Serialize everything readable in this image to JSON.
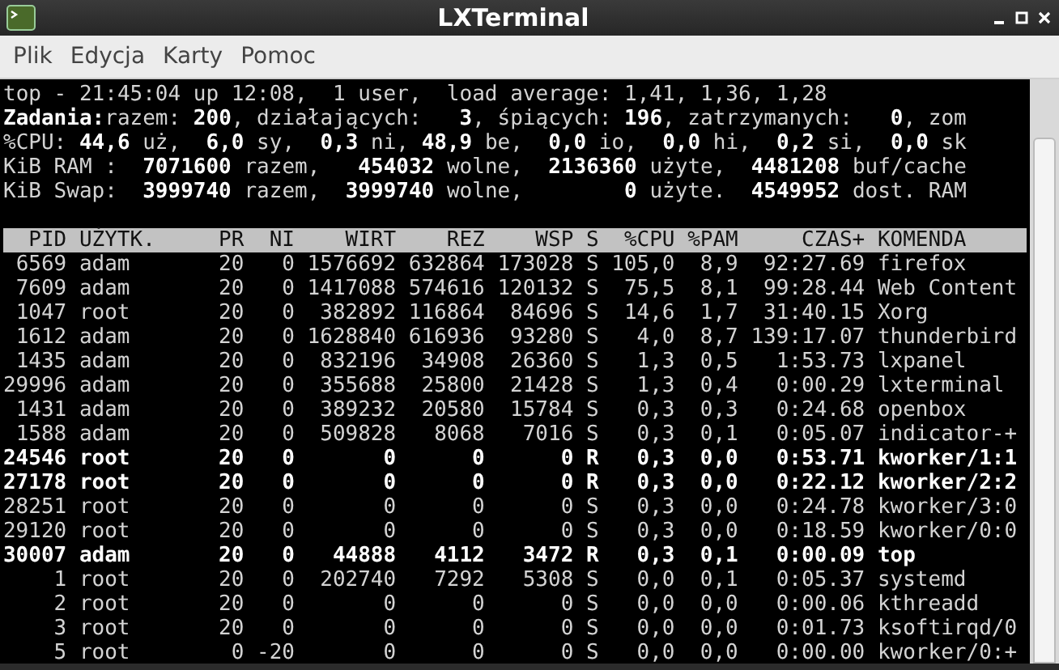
{
  "window": {
    "title": "LXTerminal"
  },
  "menu": [
    "Plik",
    "Edycja",
    "Karty",
    "Pomoc"
  ],
  "summary": [
    "top - 21:45:04 up 12:08,  1 user,  load average: 1,41, 1,36, 1,28",
    "**Zadania:**razem: **200**, działających:   **3**, śpiących: **196**, zatrzymanych:   **0**, zom",
    "%CPU: **44,6** uż,  **6,0** sy,  **0,3** ni, **48,9** be,  **0,0** io,  **0,0** hi,  **0,2** si,  **0,0** sk",
    "KiB RAM :  **7071600** razem,   **454032** wolne,  **2136360** użyte,  **4481208** buf/cache",
    "KiB Swap:  **3999740** razem,  **3999740** wolne,        **0** użyte.  **4549952** dost. RAM"
  ],
  "table": {
    "columns": [
      "PID",
      "UŻYTK.",
      "PR",
      "NI",
      "WIRT",
      "REZ",
      "WSP",
      "S",
      "%CPU",
      "%PAM",
      "CZAS+",
      "KOMENDA"
    ],
    "rows": [
      {
        "highlighted": false,
        "cells": [
          "6569",
          "adam",
          "20",
          "0",
          "1576692",
          "632864",
          "173028",
          "S",
          "105,0",
          "8,9",
          "92:27.69",
          "firefox"
        ]
      },
      {
        "highlighted": false,
        "cells": [
          "7609",
          "adam",
          "20",
          "0",
          "1417088",
          "574616",
          "120132",
          "S",
          "75,5",
          "8,1",
          "99:28.44",
          "Web Content"
        ]
      },
      {
        "highlighted": false,
        "cells": [
          "1047",
          "root",
          "20",
          "0",
          "382892",
          "116864",
          "84696",
          "S",
          "14,6",
          "1,7",
          "31:40.15",
          "Xorg"
        ]
      },
      {
        "highlighted": false,
        "cells": [
          "1612",
          "adam",
          "20",
          "0",
          "1628840",
          "616936",
          "93280",
          "S",
          "4,0",
          "8,7",
          "139:17.07",
          "thunderbird"
        ]
      },
      {
        "highlighted": false,
        "cells": [
          "1435",
          "adam",
          "20",
          "0",
          "832196",
          "34908",
          "26360",
          "S",
          "1,3",
          "0,5",
          "1:53.73",
          "lxpanel"
        ]
      },
      {
        "highlighted": false,
        "cells": [
          "29996",
          "adam",
          "20",
          "0",
          "355688",
          "25800",
          "21428",
          "S",
          "1,3",
          "0,4",
          "0:00.29",
          "lxterminal"
        ]
      },
      {
        "highlighted": false,
        "cells": [
          "1431",
          "adam",
          "20",
          "0",
          "389232",
          "20580",
          "15784",
          "S",
          "0,3",
          "0,3",
          "0:24.68",
          "openbox"
        ]
      },
      {
        "highlighted": false,
        "cells": [
          "1588",
          "adam",
          "20",
          "0",
          "509828",
          "8068",
          "7016",
          "S",
          "0,3",
          "0,1",
          "0:05.07",
          "indicator-+"
        ]
      },
      {
        "highlighted": true,
        "cells": [
          "24546",
          "root",
          "20",
          "0",
          "0",
          "0",
          "0",
          "R",
          "0,3",
          "0,0",
          "0:53.71",
          "kworker/1:1"
        ]
      },
      {
        "highlighted": true,
        "cells": [
          "27178",
          "root",
          "20",
          "0",
          "0",
          "0",
          "0",
          "R",
          "0,3",
          "0,0",
          "0:22.12",
          "kworker/2:2"
        ]
      },
      {
        "highlighted": false,
        "cells": [
          "28251",
          "root",
          "20",
          "0",
          "0",
          "0",
          "0",
          "S",
          "0,3",
          "0,0",
          "0:24.78",
          "kworker/3:0"
        ]
      },
      {
        "highlighted": false,
        "cells": [
          "29120",
          "root",
          "20",
          "0",
          "0",
          "0",
          "0",
          "S",
          "0,3",
          "0,0",
          "0:18.59",
          "kworker/0:0"
        ]
      },
      {
        "highlighted": true,
        "cells": [
          "30007",
          "adam",
          "20",
          "0",
          "44888",
          "4112",
          "3472",
          "R",
          "0,3",
          "0,1",
          "0:00.09",
          "top"
        ]
      },
      {
        "highlighted": false,
        "cells": [
          "1",
          "root",
          "20",
          "0",
          "202740",
          "7292",
          "5308",
          "S",
          "0,0",
          "0,1",
          "0:05.37",
          "systemd"
        ]
      },
      {
        "highlighted": false,
        "cells": [
          "2",
          "root",
          "20",
          "0",
          "0",
          "0",
          "0",
          "S",
          "0,0",
          "0,0",
          "0:00.06",
          "kthreadd"
        ]
      },
      {
        "highlighted": false,
        "cells": [
          "3",
          "root",
          "20",
          "0",
          "0",
          "0",
          "0",
          "S",
          "0,0",
          "0,0",
          "0:01.73",
          "ksoftirqd/0"
        ]
      },
      {
        "highlighted": false,
        "cells": [
          "5",
          "root",
          "0",
          "-20",
          "0",
          "0",
          "0",
          "S",
          "0,0",
          "0,0",
          "0:00.00",
          "kworker/0:+"
        ]
      }
    ]
  }
}
